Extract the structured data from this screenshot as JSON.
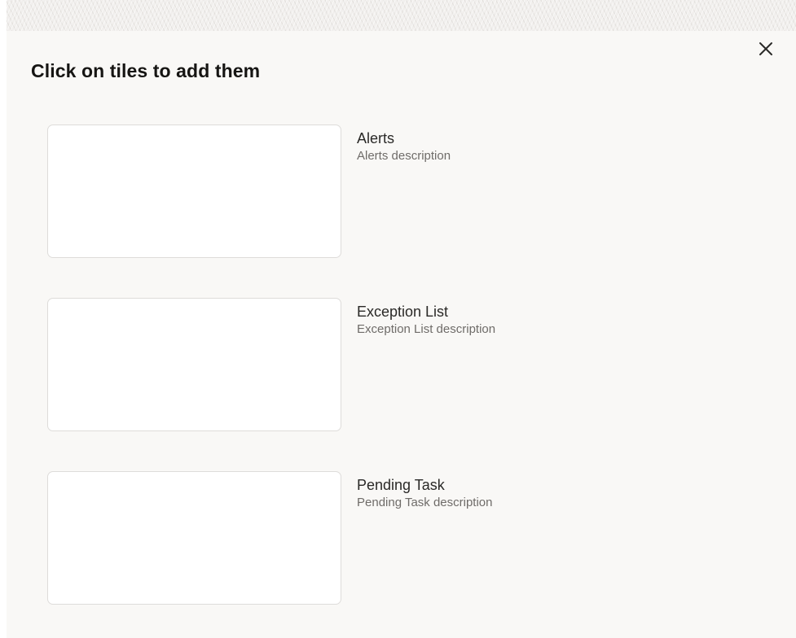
{
  "dialog": {
    "title": "Click on tiles to add them",
    "close_icon": "close-icon"
  },
  "tiles": [
    {
      "name": "Alerts",
      "description": "Alerts description"
    },
    {
      "name": "Exception List",
      "description": "Exception List description"
    },
    {
      "name": "Pending Task",
      "description": "Pending Task description"
    }
  ],
  "colors": {
    "panel_background": "#f9f8f6",
    "title_text": "#161513",
    "description_text": "#6f6c69"
  }
}
